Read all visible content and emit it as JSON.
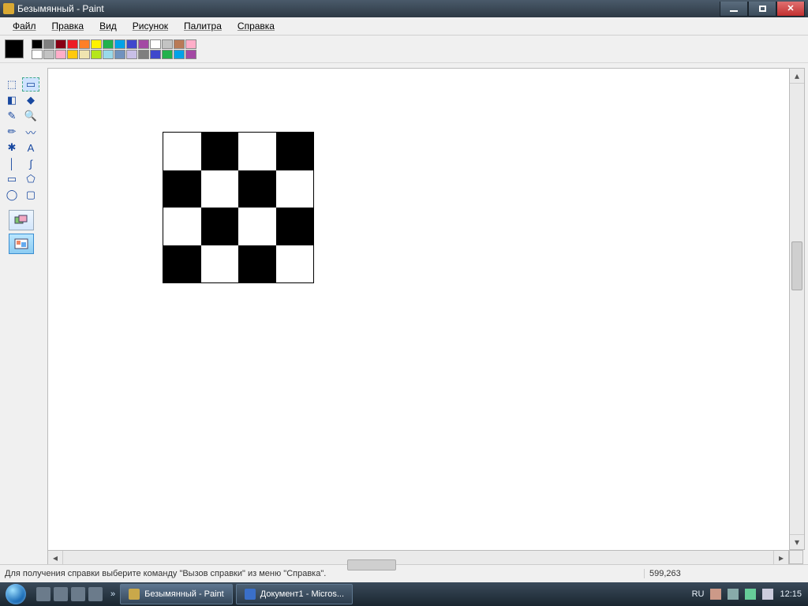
{
  "titlebar": {
    "title": "Безымянный - Paint"
  },
  "menu": {
    "file": "Файл",
    "edit": "Правка",
    "view": "Вид",
    "image": "Рисунок",
    "palette": "Палитра",
    "help": "Справка"
  },
  "colors": {
    "current": "#000000",
    "row1": [
      "#000000",
      "#7f7f7f",
      "#880015",
      "#ed1c24",
      "#ff7f27",
      "#fff200",
      "#22b14c",
      "#00a2e8",
      "#3f48cc",
      "#a349a4",
      "#ffffff",
      "#c3c3c3",
      "#b97a57",
      "#ffaec9"
    ],
    "row2": [
      "#ffffff",
      "#c3c3c3",
      "#ffaec9",
      "#ffc90e",
      "#efe4b0",
      "#b5e61d",
      "#99d9ea",
      "#7092be",
      "#c8bfe7",
      "#7f7f7f",
      "#3f48cc",
      "#22b14c",
      "#00a2e8",
      "#a349a4"
    ]
  },
  "tools": {
    "names": [
      "free-select-tool",
      "rect-select-tool",
      "eraser-tool",
      "fill-tool",
      "picker-tool",
      "magnifier-tool",
      "pencil-tool",
      "brush-tool",
      "airbrush-tool",
      "text-tool",
      "line-tool",
      "curve-tool",
      "rectangle-tool",
      "polygon-tool",
      "ellipse-tool",
      "rounded-rect-tool"
    ],
    "glyphs": [
      "⬚",
      "▭",
      "◧",
      "◆",
      "✎",
      "🔍",
      "✏",
      "〰",
      "✱",
      "A",
      "│",
      "∫",
      "▭",
      "⬠",
      "◯",
      "▢"
    ]
  },
  "canvas": {
    "chess": [
      [
        "w",
        "b",
        "w",
        "b"
      ],
      [
        "b",
        "w",
        "b",
        "w"
      ],
      [
        "w",
        "b",
        "w",
        "b"
      ],
      [
        "b",
        "w",
        "b",
        "w"
      ]
    ]
  },
  "status": {
    "help": "Для получения справки выберите команду \"Вызов справки\" из меню \"Справка\".",
    "coords": "599,263"
  },
  "taskbar": {
    "paint": "Безымянный - Paint",
    "word": "Документ1 - Micros...",
    "lang": "RU",
    "clock": "12:15"
  }
}
